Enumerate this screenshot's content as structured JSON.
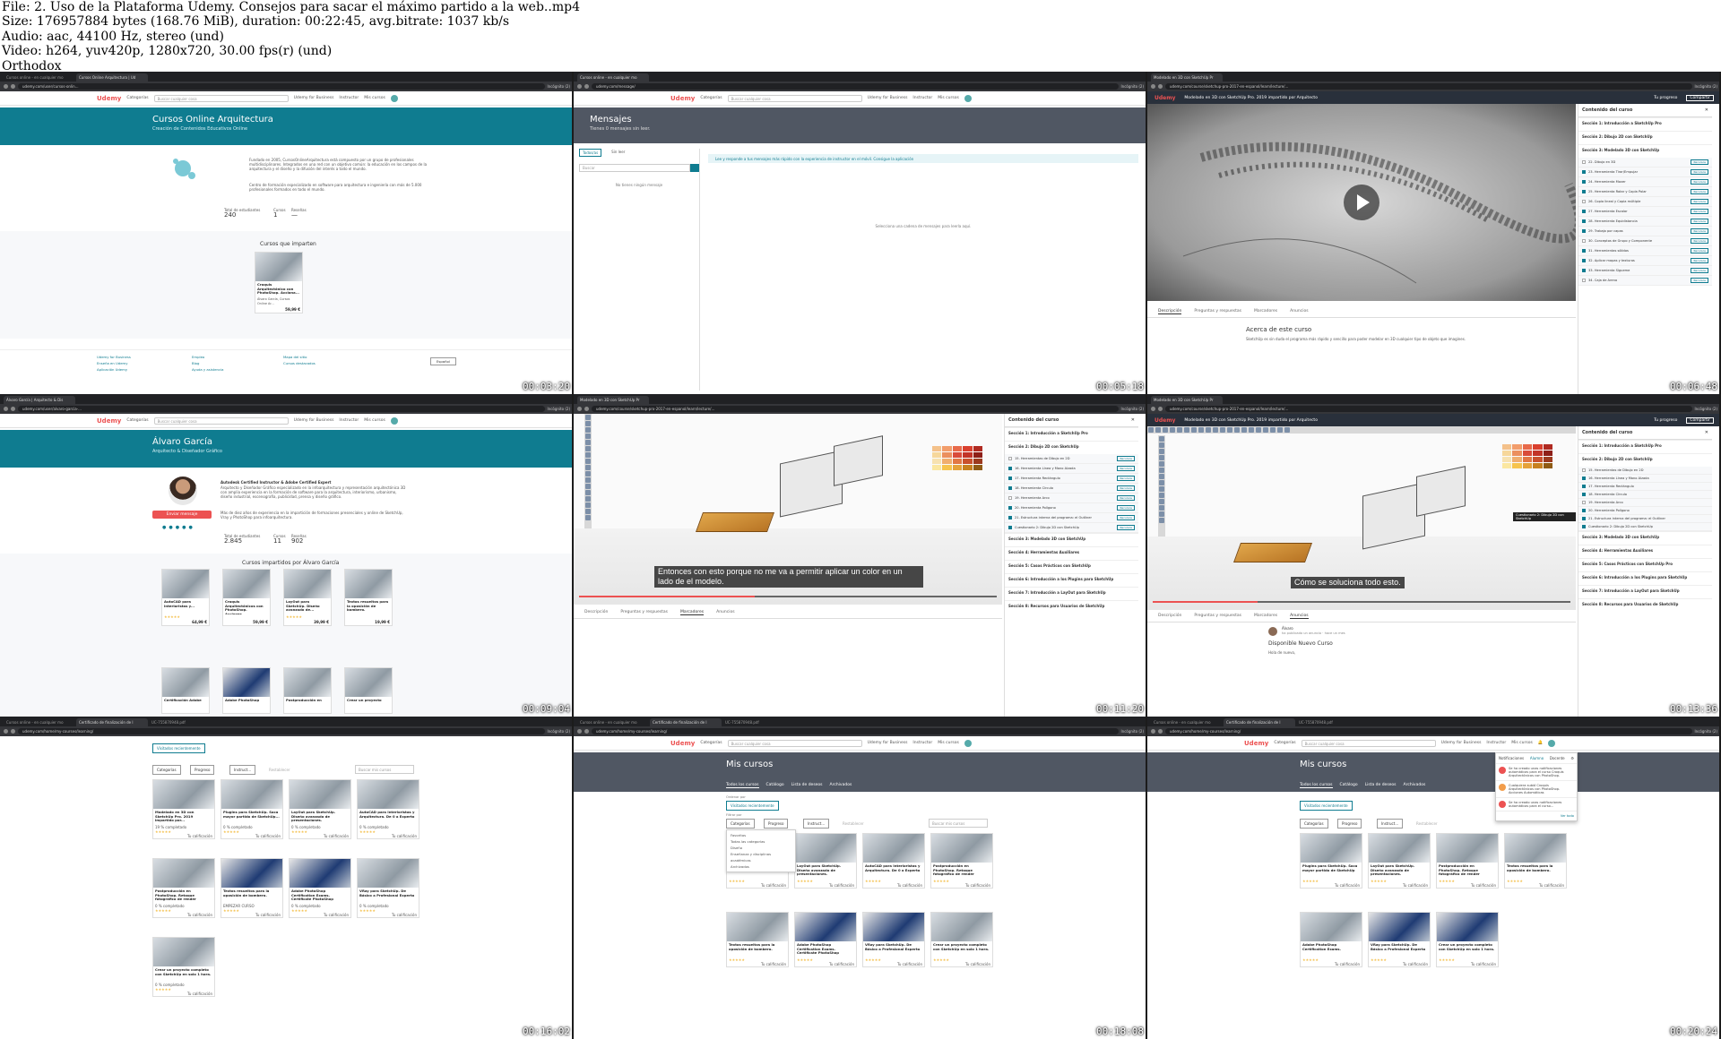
{
  "header": {
    "file": "File: 2. Uso de la Plataforma Udemy. Consejos para sacar el máximo partido a la web..mp4",
    "size": "Size: 176957884 bytes (168.76 MiB), duration: 00:22:45, avg.bitrate: 1037 kb/s",
    "audio": "Audio: aac, 44100 Hz, stereo (und)",
    "video": "Video: h264, yuv420p, 1280x720, 30.00 fps(r) (und)",
    "tag": "Orthodox"
  },
  "common": {
    "logo": "Udemy",
    "categories": "Categorías",
    "search_placeholder": "Buscar cualquier cosa",
    "udemy_business": "Udemy for Business",
    "instructor": "Instructor",
    "my_courses": "Mis cursos",
    "incognito": "Incógnito (2)",
    "language": "Español"
  },
  "tiles": [
    {
      "timestamp": "00:03:20",
      "tabs": [
        "Cursos online - en cualquier mo",
        "Cursos Online Arquitectura | Ud"
      ],
      "url": "udemy.com/user/cursos-onlin...",
      "banner_title": "Cursos Online Arquitectura",
      "banner_sub": "Creación de Contenidos Educativos Online",
      "about": "Fundado en 2005, CursosOnlineArquitectura está compuesto por un grupo de profesionales multidisciplinares. Integrados en una red con un objetivo común: la educación en los campos de la arquitectura y el diseño y la difusión del interés a todo el mundo.",
      "about2": "Centro de formación especializado en software para arquitectura e ingeniería con más de 5.000 profesionales formados en todo el mundo.",
      "stats": [
        {
          "label": "Total de estudiantes",
          "value": "240"
        },
        {
          "label": "Cursos",
          "value": "1"
        },
        {
          "label": "Reseñas",
          "value": "—"
        }
      ],
      "courses_title": "Cursos que imparten",
      "course": {
        "title": "Croquis Arquitectónico con PhotoShop. Acciona...",
        "author": "Álvaro García, Cursos Online Ar...",
        "price": "59,99 €"
      },
      "footer_links": [
        "Udemy for Business",
        "Enseña en Udemy",
        "Aplicación Udemy",
        "Empleo",
        "Blog",
        "Ayuda y asistencia",
        "Mapa del sitio",
        "Cursos destacados"
      ]
    },
    {
      "timestamp": "00:05:18",
      "tabs": [
        "Cursos online - en cualquier mo"
      ],
      "url": "udemy.com/message/",
      "title": "Mensajes",
      "subtitle": "Tienes 0 mensajes sin leer.",
      "filter_tabs": [
        "Todos/as",
        "Sin leer"
      ],
      "search": "Buscar",
      "empty_list": "No tienes ningún mensaje",
      "info": "Lee y responde a tus mensajes más rápido con la experiencia de instructor en el móvil. Consigue la aplicación",
      "empty_pane": "Selecciona una cadena de mensajes para leerla aquí."
    },
    {
      "timestamp": "00:06:48",
      "tabs": [
        "Modelado en 3D con SketchUp Pr"
      ],
      "url": "udemy.com/course/sketchup-pro-2017-en-espanol/learn/lecture/...",
      "course_title": "Modelado en 3D con SketchUp Pro. 2019 impartido por Arquitecto",
      "progress": "Tu progreso",
      "share": "Compartir",
      "sidebar_title": "Contenido del curso",
      "sections": [
        "Sección 1: Introducción a SketchUp Pro",
        "Sección 2: Dibujo 2D con SketchUp",
        "Sección 3: Modelado 3D con SketchUp"
      ],
      "lectures": [
        "22. Dibujo en 3D",
        "23. Herramienta Tirar/Empujar",
        "24. Herramienta Mover",
        "25. Herramienta Rotar y Copia Polar",
        "26. Copia lineal y Copia múltiple",
        "27. Herramienta Escalar",
        "28. Herramienta Equidistancia",
        "29. Trabajo por capas",
        "30. Conceptos de Grupo y Componente",
        "31. Herramientas sólidos",
        "32. Aplicar mapas y texturas",
        "33. Herramienta Sígueme",
        "34. Caja de Arena"
      ],
      "resources": "Recursos",
      "video_tabs": [
        "Descripción",
        "Preguntas y respuestas",
        "Marcadores",
        "Anuncios"
      ],
      "about_title": "Acerca de este curso",
      "about_text": "SketchUp es sin duda el programa más rápido y sencillo para poder modelar en 3D cualquier tipo de objeto que imagines."
    },
    {
      "timestamp": "00:09:04",
      "tabs": [
        "Álvaro García | Arquitecto & Dis"
      ],
      "url": "udemy.com/user/alvaro-garcia-...",
      "banner_title": "Álvaro García",
      "banner_sub": "Arquitecto & Diseñador Gráfico",
      "headline": "Autodesk Certified Instructor & Adobe Certified Expert",
      "bio": "Arquitecto y Diseñador Gráfico especializado en la infoarquitectura y representación arquitectónica 3D con amplia experiencia en la formación de software para la arquitectura, interiorismo, urbanismo, diseño industrial, escenografía, publicidad, prensa y diseño gráfico.",
      "bio2": "Más de diez años de experiencia en la impartición de formaciones presenciales y online de SketchUp, Vray y PhotoShop para infoarquitectura.",
      "send": "Enviar mensaje",
      "stats": [
        {
          "label": "Total de estudiantes",
          "value": "2.845"
        },
        {
          "label": "Cursos",
          "value": "11"
        },
        {
          "label": "Reseñas",
          "value": "902"
        }
      ],
      "courses_title": "Cursos impartidos por Álvaro García",
      "courses": [
        {
          "title": "AutoCAD para Interioristas y...",
          "price": "64,99 €"
        },
        {
          "title": "Croquis Arquitectónicos con PhotoShop. Acciones...",
          "price": "59,99 €"
        },
        {
          "title": "LayOut para SketchUp. Diseño avanzado de...",
          "price": "39,99 €"
        },
        {
          "title": "Textos resueltos para la oposición de bombero.",
          "price": "19,99 €"
        }
      ],
      "courses_row2": [
        "Certificación Adobe",
        "Adobe PhotoShop",
        "Postproducción en",
        "Crear un proyecto"
      ]
    },
    {
      "timestamp": "00:11:20",
      "tabs": [
        "Modelado en 3D con SketchUp Pr"
      ],
      "url": "udemy.com/course/sketchup-pro-2017-en-espanol/learn/lecture/...",
      "subtitle": "Entonces con esto porque no me va a permitir aplicar un color en un lado de el modelo.",
      "sidebar_title": "Contenido del curso",
      "sections": [
        "Sección 1: Introducción a SketchUp Pro",
        "Sección 2: Dibujo 2D con SketchUp",
        "Sección 3: Modelado 3D con SketchUp",
        "Sección 4: Herramientas Auxiliares",
        "Sección 5: Casos Prácticos con SketchUp",
        "Sección 6: Introducción a los Plugins para SketchUp",
        "Sección 7: Introducción a LayOut para SketchUp",
        "Sección 8: Recursos para Usuarios de SketchUp"
      ],
      "lectures": [
        "15. Herramientas de Dibujo en 2D",
        "16. Herramienta Línea y Mano Alzada",
        "17. Herramienta Rectángulo",
        "18. Herramienta Círculo",
        "19. Herramienta Arco",
        "20. Herramienta Polígono",
        "21. Estructura interna del programa: el Outliner",
        "Cuestionario 2: Dibujo 2D con SketchUp"
      ],
      "resources": "Recursos",
      "video_tabs": [
        "Descripción",
        "Preguntas y respuestas",
        "Marcadores",
        "Anuncios"
      ]
    },
    {
      "timestamp": "00:13:36",
      "tabs": [
        "Modelado en 3D con SketchUp Pr"
      ],
      "url": "udemy.com/course/sketchup-pro-2017-en-espanol/learn/lecture/...",
      "course_title": "Modelado en 3D con SketchUp Pro. 2019 impartido por Arquitecto",
      "progress": "Tu progreso",
      "share": "Compartir",
      "subtitle": "Cómo se soluciona todo esto.",
      "tooltip": "Cuestionario 2: Dibujo 2D con SketchUp",
      "sidebar_title": "Contenido del curso",
      "sections": [
        "Sección 1: Introducción a SketchUp Pro",
        "Sección 2: Dibujo 2D con SketchUp",
        "Sección 3: Modelado 3D con SketchUp",
        "Sección 4: Herramientas Auxiliares",
        "Sección 5: Casos Prácticos con SketchUp Pro",
        "Sección 6: Introducción a los Plugins para SketchUp",
        "Sección 7: Introducción a LayOut para SketchUp",
        "Sección 8: Recursos para Usuarios de SketchUp"
      ],
      "lectures": [
        "15. Herramientas de Dibujo en 2D",
        "16. Herramienta Línea y Mano Alzada",
        "17. Herramienta Rectángulo",
        "18. Herramienta Círculo",
        "19. Herramienta Arco",
        "20. Herramienta Polígono",
        "21. Estructura interna del programa: el Outliner",
        "Cuestionario 2: Dibujo 2D con SketchUp"
      ],
      "video_tabs": [
        "Descripción",
        "Preguntas y respuestas",
        "Marcadores",
        "Anuncios"
      ],
      "announcement_author": "Álvaro",
      "announcement_meta": "ha publicado un anuncio · hace un mes",
      "announcement_title": "Disponible Nuevo Curso",
      "announcement_body": "Hola de nuevo,"
    },
    {
      "timestamp": "00:16:02",
      "tabs": [
        "Cursos online - en cualquier mo",
        "Certificado de finalización de l",
        "UC-755870948.pdf"
      ],
      "url": "udemy.com/home/my-courses/learning/",
      "sort": "Visitados recientemente",
      "filters": [
        "Categorías",
        "Progreso",
        "Instruct..."
      ],
      "reset": "Restablecer",
      "search": "Buscar mis cursos",
      "courses": [
        {
          "title": "Modelado en 3D con SketchUp Pro. 2019 impartido por...",
          "pct": "19 % completado"
        },
        {
          "title": "Plugins para SketchUp. Saca mayor partido de SketchUp...",
          "pct": "0 % completado"
        },
        {
          "title": "LayOut para SketchUp. Diseño avanzado de presentaciones.",
          "pct": "0 % completado"
        },
        {
          "title": "AutoCAD para Interioristas y Arquitectura. De 0 a Experto",
          "pct": "0 % completado"
        },
        {
          "title": "Postproducción en PhotoShop. Retoque fotográfico de render",
          "pct": "0 % completado"
        },
        {
          "title": "Textos resueltos para la oposición de bombero.",
          "pct": "EMPEZAR CURSO"
        },
        {
          "title": "Adobe PhotoShop Certification Exams. Certificate PhotoShop",
          "pct": "0 % completado"
        },
        {
          "title": "VRay para SketchUp. De Básico a Profesional Experto",
          "pct": "0 % completado"
        },
        {
          "title": "Crear un proyecto completo con SketchUp en solo 1 hora.",
          "pct": "0 % completado"
        }
      ],
      "rate": "Tu calificación"
    },
    {
      "timestamp": "00:18:08",
      "tabs": [
        "Cursos online - en cualquier mo",
        "Certificado de finalización de l",
        "UC-755870948.pdf"
      ],
      "url": "udemy.com/home/my-courses/learning/",
      "title": "Mis cursos",
      "tabs_row": [
        "Todos los cursos",
        "Catálogo",
        "Lista de deseos",
        "Archivados"
      ],
      "sort_label": "Ordenar por",
      "sort": "Visitados recientemente",
      "filter_label": "Filtrar por",
      "filters": [
        "Categorías",
        "Progreso",
        "Instruct..."
      ],
      "reset": "Restablecer",
      "search": "Buscar mis cursos",
      "dropdown": [
        "Favoritos",
        "Todas las categorías",
        "Diseño",
        "Enseñanza y disciplinas académicas",
        "Archivados"
      ],
      "courses": [
        "Plugins para SketchUp. Saca mayor partido de SketchUp",
        "LayOut para SketchUp. Diseño avanzado de presentaciones.",
        "AutoCAD para Interioristas y Arquitectura. De 0 a Experto",
        "Postproducción en PhotoShop. Retoque fotográfico de render",
        "Textos resueltos para la oposición de bombero.",
        "Adobe PhotoShop Certification Exams. Certificate PhotoShop",
        "VRay para SketchUp. De Básico a Profesional Experto",
        "Crear un proyecto completo con SketchUp en solo 1 hora."
      ],
      "rate": "Tu calificación"
    },
    {
      "timestamp": "00:20:24",
      "tabs": [
        "Cursos online - en cualquier mo",
        "Certificado de finalización de l",
        "UC-755870948.pdf"
      ],
      "url": "udemy.com/home/my-courses/learning/",
      "title": "Mis cursos",
      "tabs_row": [
        "Todos los cursos",
        "Catálogo",
        "Lista de deseos",
        "Archivados"
      ],
      "sort": "Visitados recientemente",
      "filters": [
        "Categorías",
        "Progreso",
        "Instruct..."
      ],
      "reset": "Restablecer",
      "notif_title": "Notificaciones",
      "notif_tabs": [
        "Alumno",
        "Docente"
      ],
      "notifications": [
        "Se ha creado unas notificaciones automáticas para el curso Croquis Arquitectónicos con PhotoShop.",
        "Cualquiera subió Croquis Arquitectónicos con PhotoShop. Acciones Automáticas",
        "Se ha creado unas notificaciones automáticas para el curso..."
      ],
      "notif_see_all": "Ver todo",
      "courses": [
        "Plugins para SketchUp. Saca mayor partido de SketchUp",
        "LayOut para SketchUp. Diseño avanzado de presentaciones.",
        "Postproducción en PhotoShop. Retoque fotográfico de render",
        "Textos resueltos para la oposición de bombero.",
        "Adobe PhotoShop Certification Exams.",
        "VRay para SketchUp. De Básico a Profesional Experto",
        "Crear un proyecto completo con SketchUp en solo 1 hora."
      ],
      "rate": "Tu calificación"
    }
  ]
}
